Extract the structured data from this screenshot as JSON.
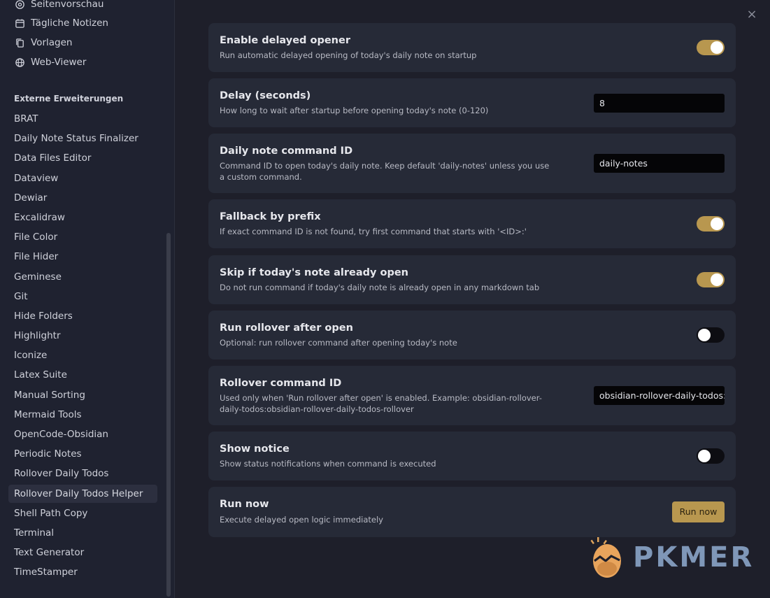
{
  "sidebar": {
    "core_items": [
      {
        "label": "Seitenvorschau",
        "icon": "preview-icon"
      },
      {
        "label": "Tägliche Notizen",
        "icon": "calendar-icon"
      },
      {
        "label": "Vorlagen",
        "icon": "copy-icon"
      },
      {
        "label": "Web-Viewer",
        "icon": "globe-icon"
      }
    ],
    "section_heading": "Externe Erweiterungen",
    "plugins": [
      "BRAT",
      "Daily Note Status Finalizer",
      "Data Files Editor",
      "Dataview",
      "Dewiar",
      "Excalidraw",
      "File Color",
      "File Hider",
      "Geminese",
      "Git",
      "Hide Folders",
      "Highlightr",
      "Iconize",
      "Latex Suite",
      "Manual Sorting",
      "Mermaid Tools",
      "OpenCode-Obsidian",
      "Periodic Notes",
      "Rollover Daily Todos",
      "Rollover Daily Todos Helper",
      "Shell Path Copy",
      "Terminal",
      "Text Generator",
      "TimeStamper"
    ],
    "active_plugin": "Rollover Daily Todos Helper"
  },
  "close_icon": "×",
  "settings": [
    {
      "name": "Enable delayed opener",
      "desc": "Run automatic delayed opening of today's daily note on startup",
      "control": "toggle",
      "on": true
    },
    {
      "name": "Delay (seconds)",
      "desc": "How long to wait after startup before opening today's note (0-120)",
      "control": "text",
      "value": "8"
    },
    {
      "name": "Daily note command ID",
      "desc": "Command ID to open today's daily note. Keep default 'daily-notes' unless you use a custom command.",
      "control": "text",
      "value": "daily-notes"
    },
    {
      "name": "Fallback by prefix",
      "desc": "If exact command ID is not found, try first command that starts with '<ID>:'",
      "control": "toggle",
      "on": true
    },
    {
      "name": "Skip if today's note already open",
      "desc": "Do not run command if today's daily note is already open in any markdown tab",
      "control": "toggle",
      "on": true
    },
    {
      "name": "Run rollover after open",
      "desc": "Optional: run rollover command after opening today's note",
      "control": "toggle",
      "on": false
    },
    {
      "name": "Rollover command ID",
      "desc": "Used only when 'Run rollover after open' is enabled. Example: obsidian-rollover-daily-todos:obsidian-rollover-daily-todos-rollover",
      "control": "text",
      "value": "obsidian-rollover-daily-todos:obsidian-rollover-daily-todos-rollover"
    },
    {
      "name": "Show notice",
      "desc": "Show status notifications when command is executed",
      "control": "toggle",
      "on": false
    },
    {
      "name": "Run now",
      "desc": "Execute delayed open logic immediately",
      "control": "button",
      "button_label": "Run now"
    }
  ],
  "watermark": {
    "text": "PKMER"
  },
  "colors": {
    "accent": "#b8974f",
    "background": "#1e1f2a",
    "card": "#262a37"
  }
}
